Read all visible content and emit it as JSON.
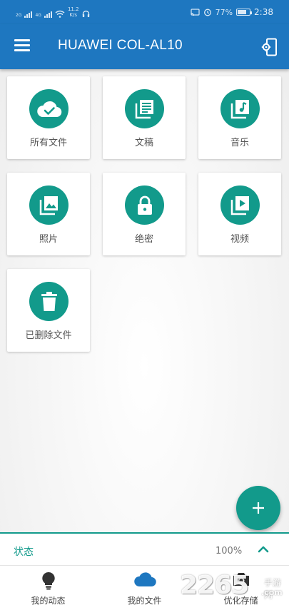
{
  "status_bar": {
    "sim1_label": "2G",
    "sim2_label": "4G",
    "net_speed_value": "11.2",
    "net_speed_unit": "K/s",
    "battery_percent": "77%",
    "battery_level": 0.77,
    "time": "2:38"
  },
  "app_bar": {
    "title": "HUAWEI COL-AL10"
  },
  "tiles": [
    {
      "label": "所有文件",
      "icon": "cloud-check-icon"
    },
    {
      "label": "文稿",
      "icon": "document-stack-icon"
    },
    {
      "label": "音乐",
      "icon": "music-note-icon"
    },
    {
      "label": "照片",
      "icon": "photo-icon"
    },
    {
      "label": "绝密",
      "icon": "lock-icon"
    },
    {
      "label": "视频",
      "icon": "video-play-icon"
    },
    {
      "label": "已删除文件",
      "icon": "trash-icon"
    }
  ],
  "fab": {
    "icon": "plus-icon"
  },
  "status_panel": {
    "label": "状态",
    "value": "100%"
  },
  "bottom_nav": [
    {
      "label": "我的动态",
      "icon": "lightbulb-icon",
      "active": false
    },
    {
      "label": "我的文件",
      "icon": "cloud-icon",
      "active": true
    },
    {
      "label": "优化存储",
      "icon": "camera-icon",
      "active": false
    }
  ],
  "watermark": {
    "number": "2265",
    "top": "手游网",
    "bottom": ".com"
  },
  "colors": {
    "primary": "#1e77c0",
    "accent": "#129a8b",
    "active_nav": "#1e77c0"
  }
}
